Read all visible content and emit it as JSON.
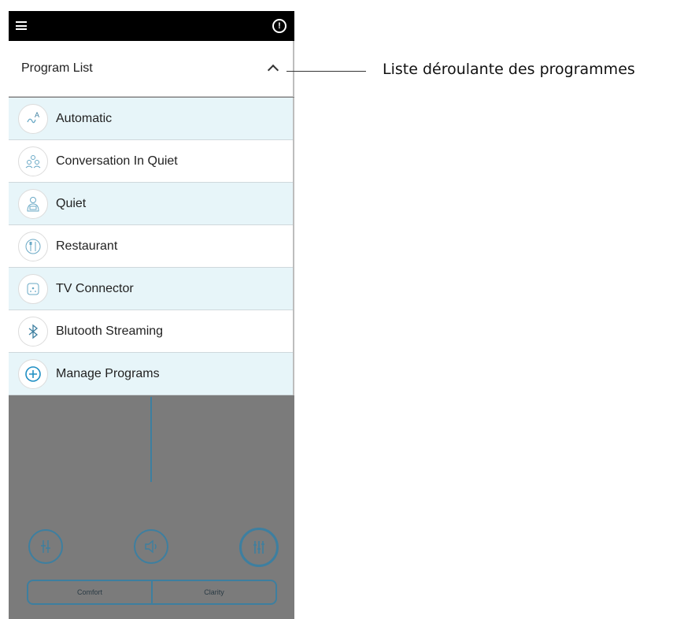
{
  "header": {
    "title": "Program List"
  },
  "programs": [
    {
      "label": "Automatic",
      "icon": "automatic-icon"
    },
    {
      "label": "Conversation In Quiet",
      "icon": "conversation-icon"
    },
    {
      "label": "Quiet",
      "icon": "quiet-icon"
    },
    {
      "label": "Restaurant",
      "icon": "restaurant-icon"
    },
    {
      "label": "TV Connector",
      "icon": "tv-connector-icon"
    },
    {
      "label": "Blutooth Streaming",
      "icon": "bluetooth-icon"
    },
    {
      "label": "Manage Programs",
      "icon": "plus-circle-icon"
    }
  ],
  "controls": {
    "left_label": "Comfort",
    "right_label": "Clarity"
  },
  "annotation": "Liste déroulante des programmes",
  "colors": {
    "accent": "#3d7fa0",
    "row_shade": "#e7f5f9",
    "overlay": "#7b7b7b"
  }
}
